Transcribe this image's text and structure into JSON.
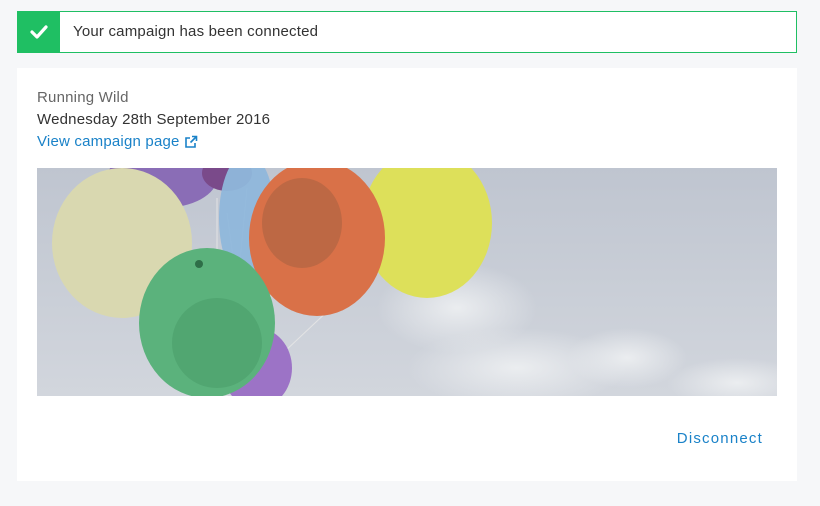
{
  "alert": {
    "message": "Your campaign has been connected",
    "icon": "check-icon",
    "color": "#1fbf63"
  },
  "campaign": {
    "name": "Running Wild",
    "date": "Wednesday 28th September 2016",
    "link_label": "View campaign page",
    "link_icon": "external-link-icon",
    "image": "balloons-photo"
  },
  "actions": {
    "disconnect_label": "Disconnect"
  },
  "colors": {
    "accent": "#1a82c8",
    "success": "#1fbf63",
    "background": "#f6f7f9"
  }
}
